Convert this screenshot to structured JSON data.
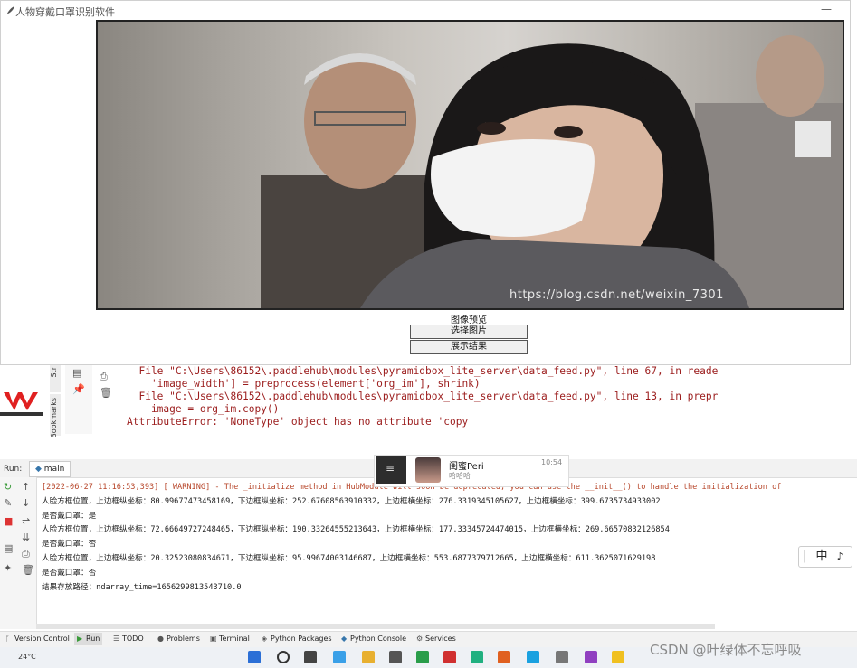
{
  "tk_window": {
    "title": "人物穿戴口罩识别软件",
    "minimize_glyph": "—",
    "preview_label": "图像预览",
    "select_button": "选择图片",
    "show_button": "展示结果",
    "watermark": "https://blog.csdn.net/weixin_7301"
  },
  "ide_background": {
    "trace_lines": [
      "  File \"C:\\Users\\86152\\.paddlehub\\modules\\pyramidbox_lite_server\\data_feed.py\", line 67, in reade",
      "    'image_width'] = preprocess(element['org_im'], shrink)",
      "  File \"C:\\Users\\86152\\.paddlehub\\modules\\pyramidbox_lite_server\\data_feed.py\", line 13, in prepr",
      "    image = org_im.copy()",
      "AttributeError: 'NoneType' object has no attribute 'copy'"
    ],
    "bookmarks_label": "Bookmarks",
    "structure_label": "Str"
  },
  "run_panel": {
    "run_label": "Run:",
    "tab": "main",
    "warning_line": "[2022-06-27 11:16:53,393] [ WARNING] - The _initialize method in HubModule will soon be deprecated, you can use the __init__() to handle the initialization of",
    "output_lines": [
      "人脸方框位置，上边框纵坐标：80.99677473458169，下边框纵坐标：252.67608563910332，上边框横坐标：276.3319345105627，上边框横坐标：399.6735734933002",
      "是否戴口罩：是",
      "人脸方框位置，上边框纵坐标：72.66649727248465，下边框纵坐标：190.33264555213643，上边框横坐标：177.33345724474015，上边框横坐标：269.66570832126854",
      "是否戴口罩：否",
      "人脸方框位置，上边框纵坐标：20.32523080834671，下边框纵坐标：95.99674003146687，上边框横坐标：553.6877379712665，上边框横坐标：611.3625071629198",
      "是否戴口罩：否",
      "结果存放路径：ndarray_time=1656299813543710.0"
    ]
  },
  "chat_popup": {
    "name": "闺蜜Peri",
    "subtitle": "哈哈哈",
    "time": "10:54"
  },
  "ime_indicator": "中",
  "bottom_toolbar": [
    "Version Control",
    "Run",
    "TODO",
    "Problems",
    "Terminal",
    "Python Packages",
    "Python Console",
    "Services"
  ],
  "weather": "24°C",
  "csdn_watermark": "CSDN @叶绿体不忘呼吸",
  "colors": {
    "trace": "#9b1c1c",
    "warning": "#b7462a",
    "accent_red": "#e02020"
  }
}
